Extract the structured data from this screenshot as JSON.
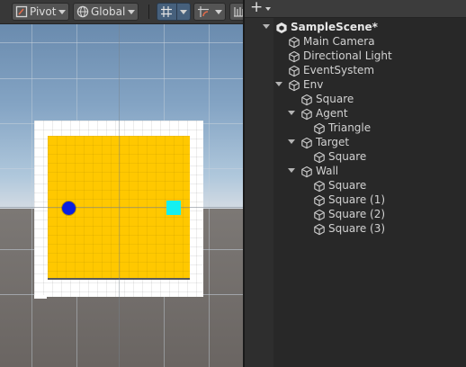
{
  "scene_toolbar": {
    "pivot_label": "Pivot",
    "global_label": "Global",
    "icons": [
      "pivot-icon",
      "global-icon",
      "grid-snap-icon",
      "increment-snap-icon",
      "ruler-icon"
    ]
  },
  "hierarchy": {
    "add_label": "+",
    "items": [
      {
        "label": "SampleScene*",
        "depth": 0,
        "expandable": true,
        "kind": "scene"
      },
      {
        "label": "Main Camera",
        "depth": 1,
        "expandable": false,
        "kind": "object"
      },
      {
        "label": "Directional Light",
        "depth": 1,
        "expandable": false,
        "kind": "object"
      },
      {
        "label": "EventSystem",
        "depth": 1,
        "expandable": false,
        "kind": "object"
      },
      {
        "label": "Env",
        "depth": 1,
        "expandable": true,
        "kind": "object"
      },
      {
        "label": "Square",
        "depth": 2,
        "expandable": false,
        "kind": "object"
      },
      {
        "label": "Agent",
        "depth": 2,
        "expandable": true,
        "kind": "object"
      },
      {
        "label": "Triangle",
        "depth": 3,
        "expandable": false,
        "kind": "object"
      },
      {
        "label": "Target",
        "depth": 2,
        "expandable": true,
        "kind": "object"
      },
      {
        "label": "Square",
        "depth": 3,
        "expandable": false,
        "kind": "object"
      },
      {
        "label": "Wall",
        "depth": 2,
        "expandable": true,
        "kind": "object"
      },
      {
        "label": "Square",
        "depth": 3,
        "expandable": false,
        "kind": "object"
      },
      {
        "label": "Square (1)",
        "depth": 3,
        "expandable": false,
        "kind": "object"
      },
      {
        "label": "Square (2)",
        "depth": 3,
        "expandable": false,
        "kind": "object"
      },
      {
        "label": "Square (3)",
        "depth": 3,
        "expandable": false,
        "kind": "object"
      }
    ]
  },
  "colors": {
    "env_floor": "#ffc800",
    "wall": "#ffffff",
    "agent": "#0a1fe0",
    "target": "#14f0f0",
    "panel_bg": "#282828",
    "toolbar_bg": "#383838",
    "button_active": "#46607c"
  }
}
